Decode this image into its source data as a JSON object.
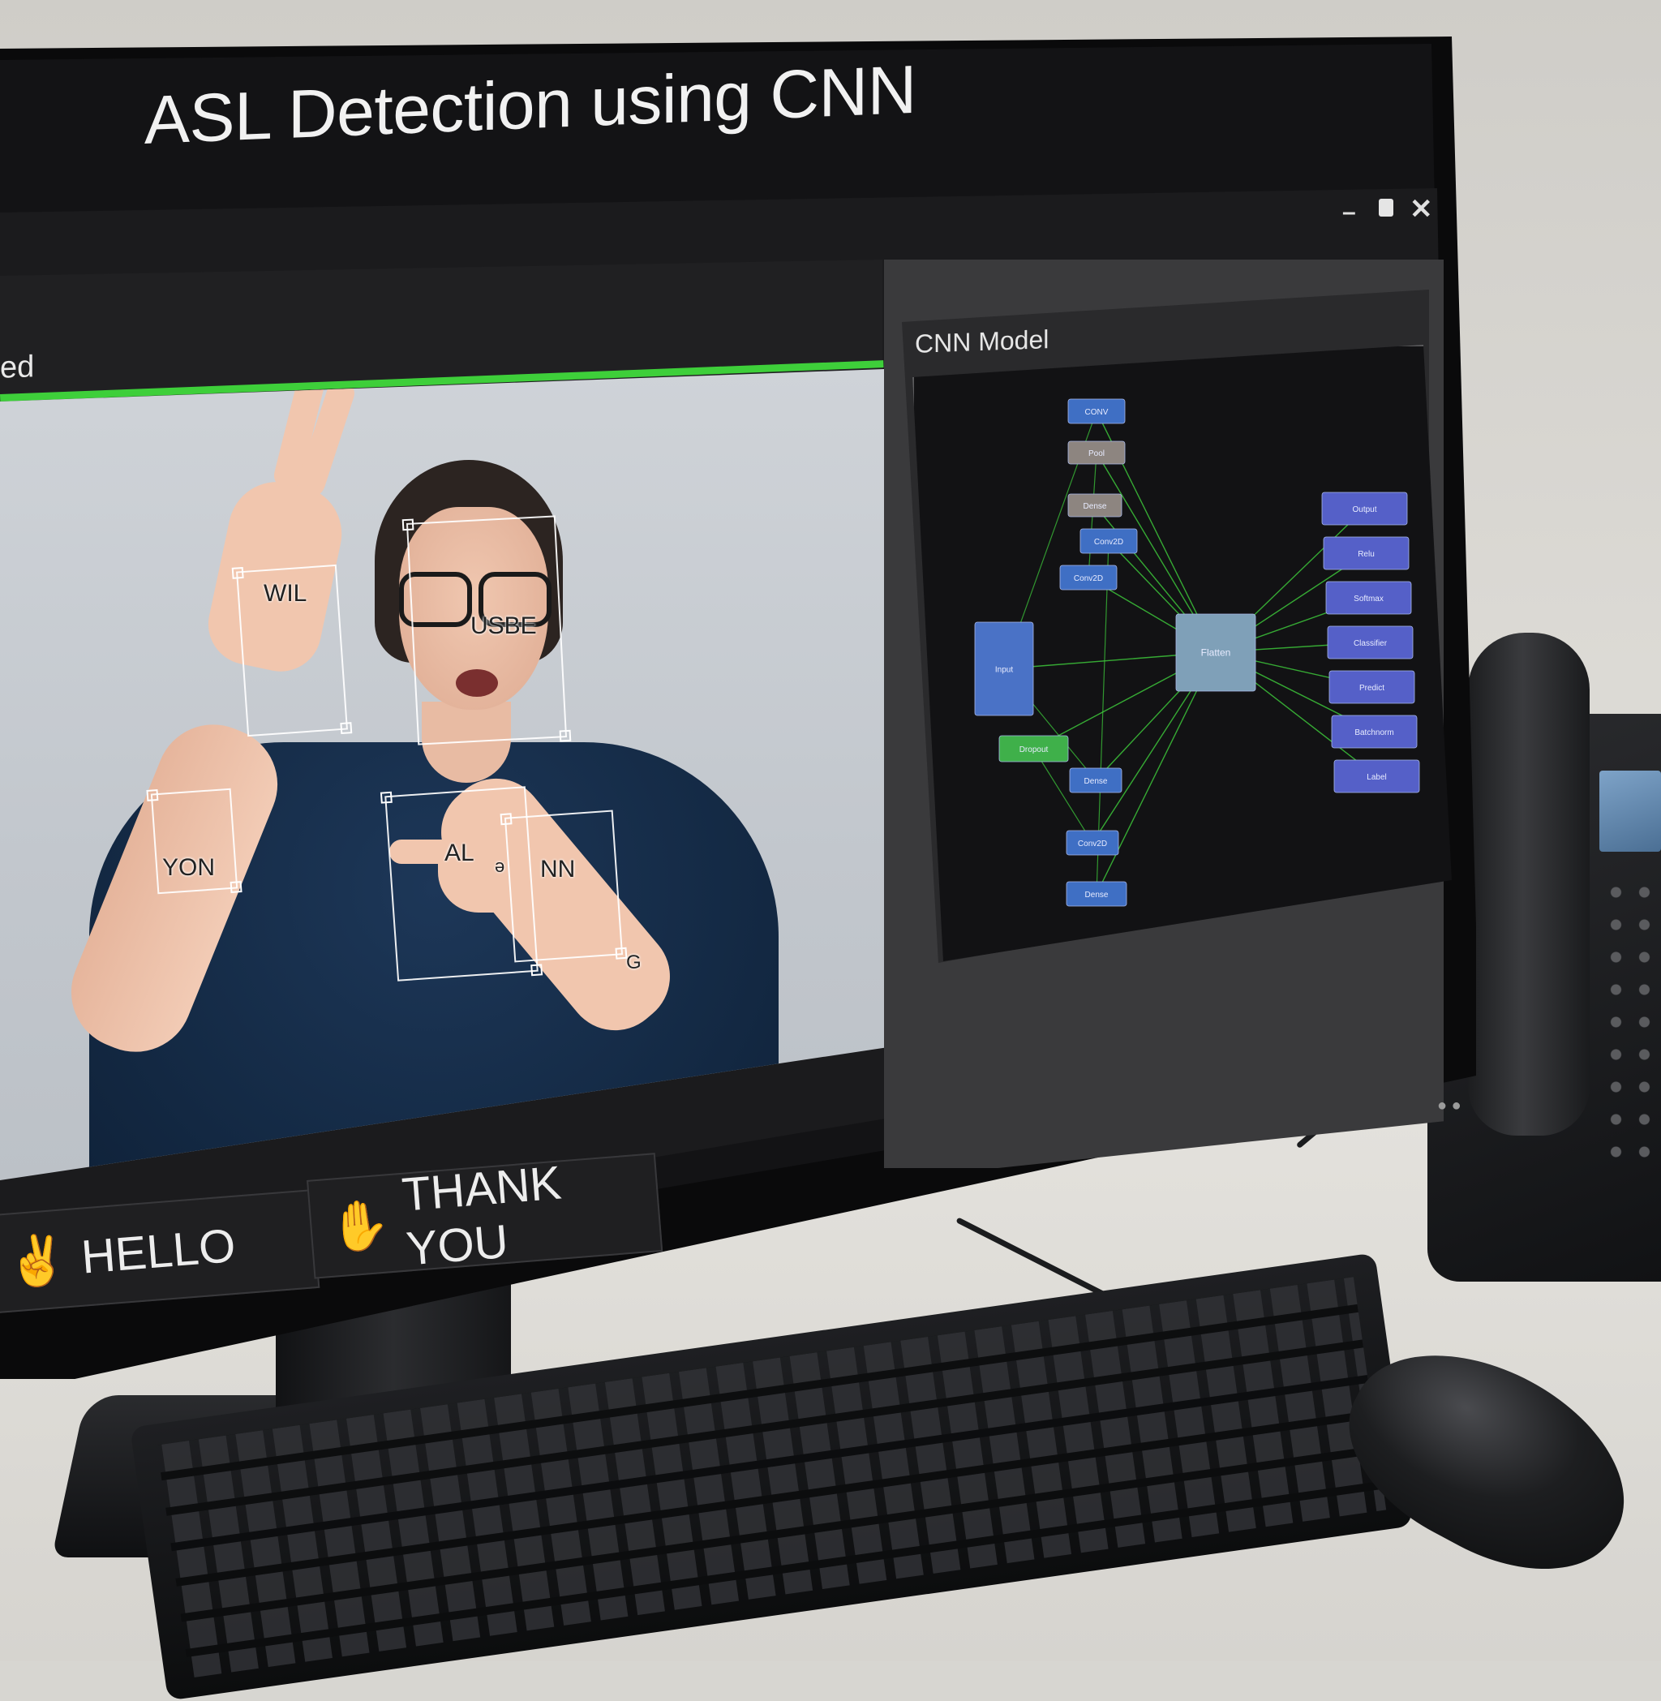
{
  "app": {
    "title": "ASL Detection using CNN"
  },
  "window_controls": {
    "minimize": "–",
    "close": "✕"
  },
  "video_panel": {
    "header": "ed",
    "detections": [
      {
        "label": "WIL"
      },
      {
        "label": "USBE"
      },
      {
        "label": "YON"
      },
      {
        "label": "AL"
      },
      {
        "label": "ə"
      },
      {
        "label": "NN"
      },
      {
        "label": "G"
      }
    ]
  },
  "model_panel": {
    "title": "CNN Model",
    "nodes": [
      {
        "label": "CONV",
        "color": "#3f6fc4"
      },
      {
        "label": "Pool",
        "color": "#8d8580"
      },
      {
        "label": "Dense",
        "color": "#8d8580"
      },
      {
        "label": "Conv2D",
        "color": "#3f6fc4"
      },
      {
        "label": "Conv2D",
        "color": "#3f6fc4"
      },
      {
        "label": "Input",
        "color": "#4a72c6"
      },
      {
        "label": "Dropout",
        "color": "#3fb04a"
      },
      {
        "label": "Dense",
        "color": "#3f6fc4"
      },
      {
        "label": "Conv2D",
        "color": "#3f6fc4"
      },
      {
        "label": "Dense",
        "color": "#3f6fc4"
      },
      {
        "label": "Flatten",
        "color": "#7fa0b8"
      },
      {
        "label": "Output",
        "color": "#5560c8"
      },
      {
        "label": "Relu",
        "color": "#5560c8"
      },
      {
        "label": "Softmax",
        "color": "#5560c8"
      },
      {
        "label": "Classifier",
        "color": "#5560c8"
      },
      {
        "label": "Predict",
        "color": "#5560c8"
      },
      {
        "label": "Batchnorm",
        "color": "#5560c8"
      },
      {
        "label": "Label",
        "color": "#5560c8"
      }
    ],
    "edge_color": "#3fd13c"
  },
  "predictions": [
    {
      "label": "HELLO",
      "icon": "hand-peace-icon"
    },
    {
      "label": "THANK YOU",
      "icon": "hand-thanks-icon"
    }
  ],
  "colors": {
    "accent_green": "#3ecf3a",
    "screen_bg": "#131315"
  }
}
